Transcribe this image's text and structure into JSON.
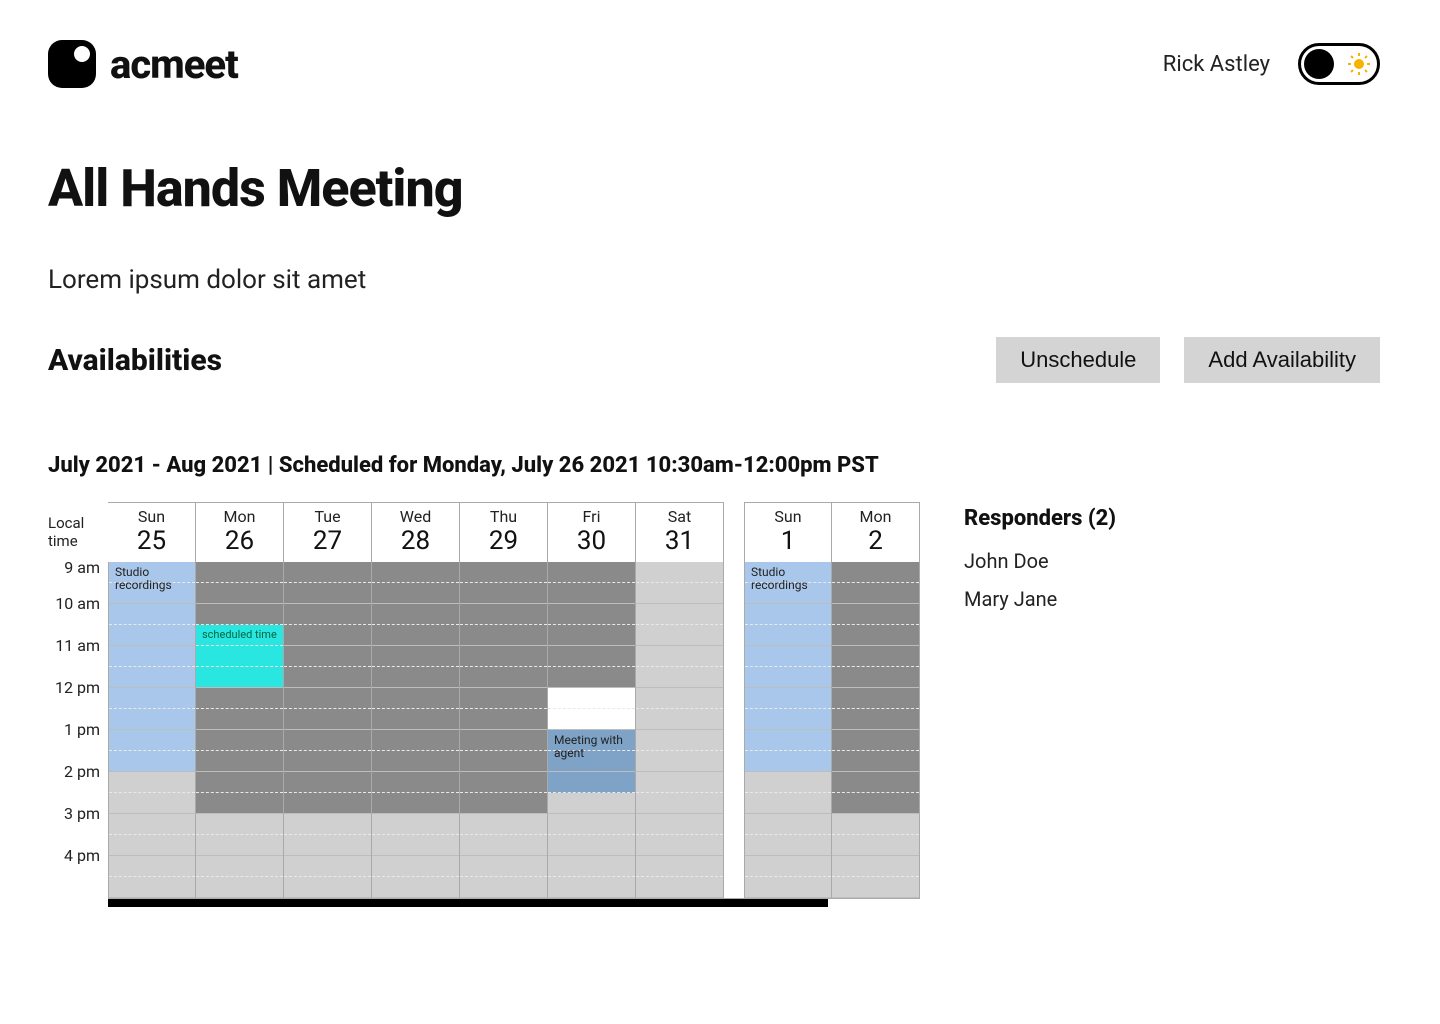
{
  "header": {
    "brand": "acmeet",
    "username": "Rick Astley"
  },
  "page": {
    "title": "All Hands Meeting",
    "subtitle": "Lorem ipsum dolor sit amet",
    "section": "Availabilities",
    "unschedule_label": "Unschedule",
    "add_availability_label": "Add Availability",
    "schedule_summary": "July 2021 - Aug  2021 | Scheduled for Monday, July 26 2021 10:30am-12:00pm PST"
  },
  "grid": {
    "time_col_header": "Local time",
    "days": [
      {
        "dow": "Sun",
        "num": "25"
      },
      {
        "dow": "Mon",
        "num": "26"
      },
      {
        "dow": "Tue",
        "num": "27"
      },
      {
        "dow": "Wed",
        "num": "28"
      },
      {
        "dow": "Thu",
        "num": "29"
      },
      {
        "dow": "Fri",
        "num": "30"
      },
      {
        "dow": "Sat",
        "num": "31"
      },
      {
        "dow": "Sun",
        "num": "1"
      },
      {
        "dow": "Mon",
        "num": "2"
      }
    ],
    "time_labels": [
      "9 am",
      "10 am",
      "11 am",
      "12 pm",
      "1 pm",
      "2 pm",
      "3 pm",
      "4 pm"
    ],
    "events": {
      "sun25_studio": "Studio recordings",
      "mon26_scheduled": "scheduled time",
      "fri30_meeting": "Meeting with agent",
      "sun1_studio": "Studio recordings"
    }
  },
  "responders": {
    "title": "Responders  (2)",
    "list": [
      "John Doe",
      "Mary Jane"
    ]
  }
}
